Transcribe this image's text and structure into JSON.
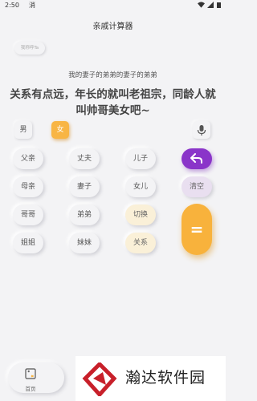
{
  "status_bar": {
    "time": "2:50",
    "app_icon": "消"
  },
  "header": {
    "title": "亲戚计算器"
  },
  "my_button": {
    "label": "我称呼Ta"
  },
  "result": {
    "question": "我的妻子的弟弟的妻子的弟弟",
    "answer": "关系有点远，年长的就叫老祖宗，同龄人就叫帅哥美女吧~"
  },
  "gender": {
    "male": "男",
    "female": "女",
    "selected": "女"
  },
  "keys": {
    "father": "父亲",
    "husband": "丈夫",
    "son": "儿子",
    "mother": "母亲",
    "wife": "妻子",
    "daughter": "女儿",
    "clear": "清空",
    "elder_brother": "哥哥",
    "younger_brother": "弟弟",
    "switch": "切换",
    "elder_sister": "姐姐",
    "younger_sister": "妹妹",
    "relation": "关系",
    "equals": "="
  },
  "tabbar": {
    "home": "首页"
  },
  "watermark": {
    "text": "瀚达软件园"
  },
  "colors": {
    "accent_orange": "#f8b23c",
    "accent_purple": "#8a35c9"
  }
}
